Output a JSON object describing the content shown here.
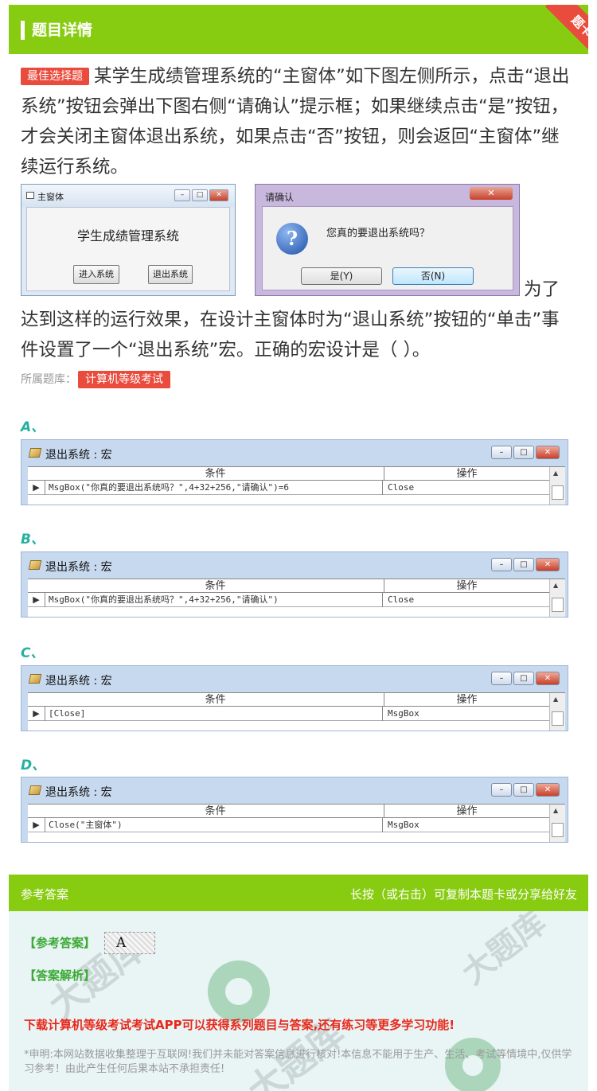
{
  "header": {
    "title": "题目详情",
    "corner_badge": "题卡"
  },
  "question": {
    "tag": "最佳选择题",
    "text": "某学生成绩管理系统的“主窗体”如下图左侧所示，点击“退出系统”按钮会弹出下图右侧“请确认”提示框；如果继续点击“是”按钮，才会关闭主窗体退出系统，如果点击“否”按钮，则会返回“主窗体”继续运行系统。",
    "tail_first": "为了",
    "tail_rest": "达到这样的运行效果，在设计主窗体时为“退山系统”按钮的“单击”事件设置了一个“退出系统”宏。正确的宏设计是（ ）。"
  },
  "main_window": {
    "title": "主窗体",
    "label": "学生成绩管理系统",
    "enter_button": "进入系统",
    "exit_button": "退出系统",
    "title_buttons": [
      "–",
      "□",
      "✕"
    ]
  },
  "confirm_dialog": {
    "title": "请确认",
    "close": "✕",
    "message": "您真的要退出系统吗？",
    "yes_button": "是(Y)",
    "no_button": "否(N)",
    "icon_glyph": "?"
  },
  "source": {
    "label": "所属题库：",
    "library": "计算机等级考试"
  },
  "options": [
    {
      "letter": "A、",
      "window_title": "退出系统 : 宏",
      "col_condition": "条件",
      "col_action": "操作",
      "condition": "MsgBox(\"你真的要退出系统吗？\",4+32+256,\"请确认\")=6",
      "action": "Close"
    },
    {
      "letter": "B、",
      "window_title": "退出系统 : 宏",
      "col_condition": "条件",
      "col_action": "操作",
      "condition": "MsgBox(\"你真的要退出系统吗？\",4+32+256,\"请确认\")",
      "action": "Close"
    },
    {
      "letter": "C、",
      "window_title": "退出系统 : 宏",
      "col_condition": "条件",
      "col_action": "操作",
      "condition": "[Close]",
      "action": "MsgBox"
    },
    {
      "letter": "D、",
      "window_title": "退出系统 : 宏",
      "col_condition": "条件",
      "col_action": "操作",
      "condition": "Close(\"主窗体\")",
      "action": "MsgBox"
    }
  ],
  "answer": {
    "header_left": "参考答案",
    "header_right": "长按（或右击）可复制本题卡或分享给好友",
    "answer_label": "【参考答案】",
    "answer_value": "A",
    "analysis_label": "【答案解析】",
    "promo": "下载计算机等级考试考试APP可以获得系列题目与答案,还有练习等更多学习功能!",
    "disclaimer": "*申明:本网站数据收集整理于互联网!我们并未能对答案信息进行核对!本信息不能用于生产、生活、考试等情境中,仅供学习参考！由此产生任何后果本站不承担责任!"
  },
  "colors": {
    "brand_green": "#88cc11",
    "tag_red": "#e94b3c",
    "option_teal": "#25b0a0",
    "answer_green": "#3aaa35",
    "promo_red": "#e8281c"
  }
}
